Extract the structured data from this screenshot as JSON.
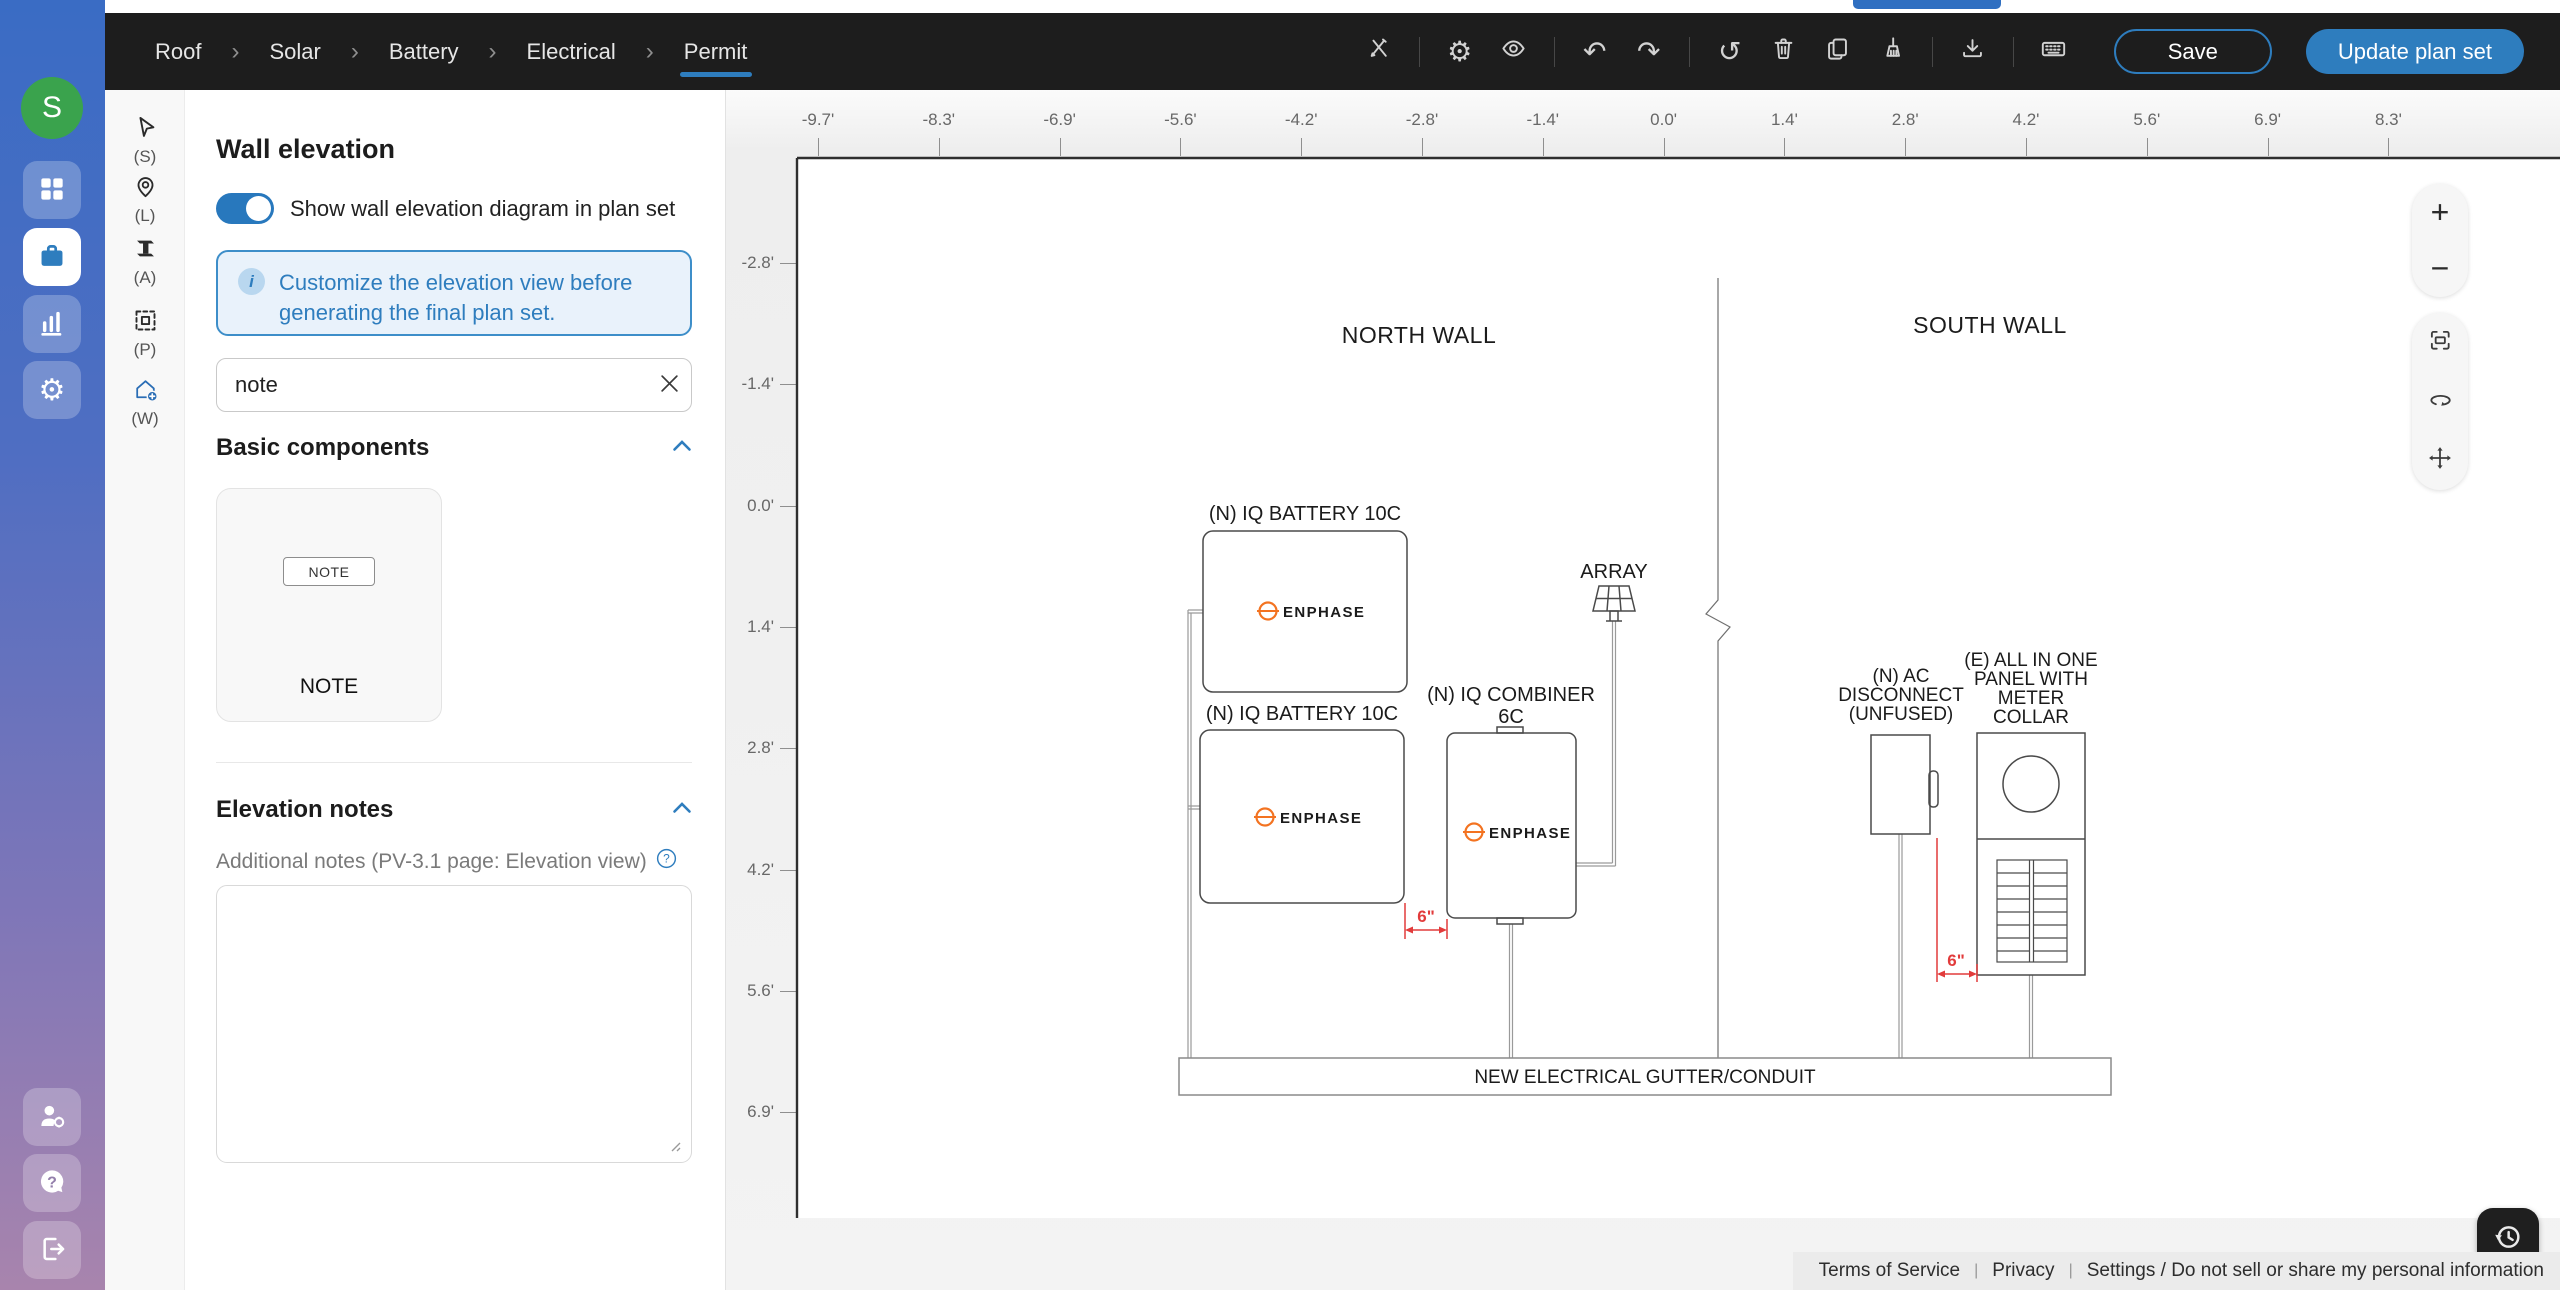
{
  "header": {
    "breadcrumbs": [
      "Roof",
      "Solar",
      "Battery",
      "Electrical",
      "Permit"
    ],
    "save_label": "Save",
    "update_label": "Update plan set"
  },
  "rail": {
    "avatar_initial": "S"
  },
  "tool_rail": {
    "select_label": "(S)",
    "location_label": "(L)",
    "attachment_label": "(A)",
    "panel_label": "(P)",
    "wall_label": "(W)"
  },
  "panel": {
    "title": "Wall elevation",
    "toggle_label": "Show wall elevation diagram in plan set",
    "info_text": "Customize the elevation view before generating the final plan set.",
    "search_value": "note",
    "basic_header": "Basic components",
    "component_thumb_label": "NOTE",
    "component_label": "NOTE",
    "elevation_header": "Elevation notes",
    "notes_label": "Additional notes (PV-3.1 page: Elevation view)"
  },
  "canvas": {
    "h_ruler": [
      "-9.7'",
      "-8.3'",
      "-6.9'",
      "-5.6'",
      "-4.2'",
      "-2.8'",
      "-1.4'",
      "0.0'",
      "1.4'",
      "2.8'",
      "4.2'",
      "5.6'",
      "6.9'",
      "8.3'"
    ],
    "v_ruler": [
      "-2.8'",
      "-1.4'",
      "0.0'",
      "1.4'",
      "2.8'",
      "4.2'",
      "5.6'",
      "6.9'"
    ],
    "drawing": {
      "north_wall": "NORTH WALL",
      "south_wall": "SOUTH WALL",
      "battery1_label": "(N) IQ BATTERY 10C",
      "battery2_label": "(N) IQ BATTERY 10C",
      "combiner_label": [
        "(N) IQ COMBINER",
        "6C"
      ],
      "array_label": "ARRAY",
      "disconnect_label": [
        "(N) AC",
        "DISCONNECT",
        "(UNFUSED)"
      ],
      "panel_label": [
        "(E) ALL IN ONE",
        "PANEL WITH",
        "METER",
        "COLLAR"
      ],
      "gutter_label": "NEW ELECTRICAL GUTTER/CONDUIT",
      "dim_battery_combiner": "6\"",
      "dim_disconnect_panel": "6\"",
      "brand": "ENPHASE"
    },
    "zoom": {
      "in": "+",
      "out": "−"
    }
  },
  "footer": {
    "terms": "Terms of Service",
    "privacy": "Privacy",
    "settings": "Settings / Do not sell or share my personal information",
    "sep": "|"
  },
  "colors": {
    "accent": "#2e7dbe",
    "enphase_orange": "#f37321",
    "dimension_red": "#e23b3b",
    "avatar_green": "#3aa34d",
    "toolbar_bg": "#1d1d1d"
  }
}
